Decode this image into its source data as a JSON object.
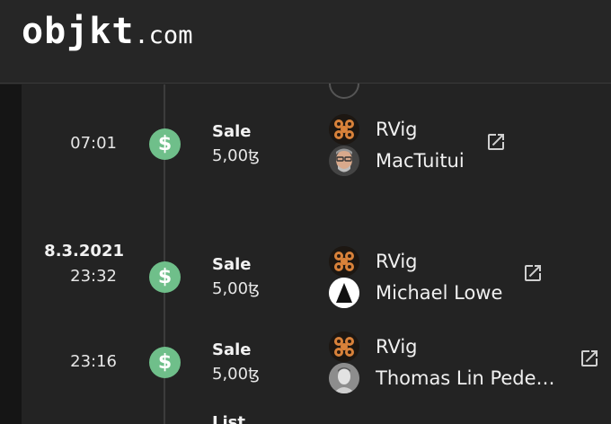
{
  "header": {
    "logo_main": "objkt",
    "logo_tld": ".com"
  },
  "events": [
    {
      "date": "",
      "time": "07:01",
      "type": "Sale",
      "price": "5,00ꜩ",
      "from": "RVig",
      "to": "MacTuitui"
    },
    {
      "date": "8.3.2021",
      "time": "23:32",
      "type": "Sale",
      "price": "5,00ꜩ",
      "from": "RVig",
      "to": "Michael Lowe"
    },
    {
      "date": "",
      "time": "23:16",
      "type": "Sale",
      "price": "5,00ꜩ",
      "from": "RVig",
      "to": "Thomas Lin Pede…"
    },
    {
      "type": "List"
    }
  ],
  "icons": {
    "sale": "dollar-icon",
    "external": "external-link-icon"
  },
  "colors": {
    "background": "#232323",
    "header": "#262626",
    "sale_badge": "#6fbf8a",
    "timeline": "#3c3c3c"
  }
}
